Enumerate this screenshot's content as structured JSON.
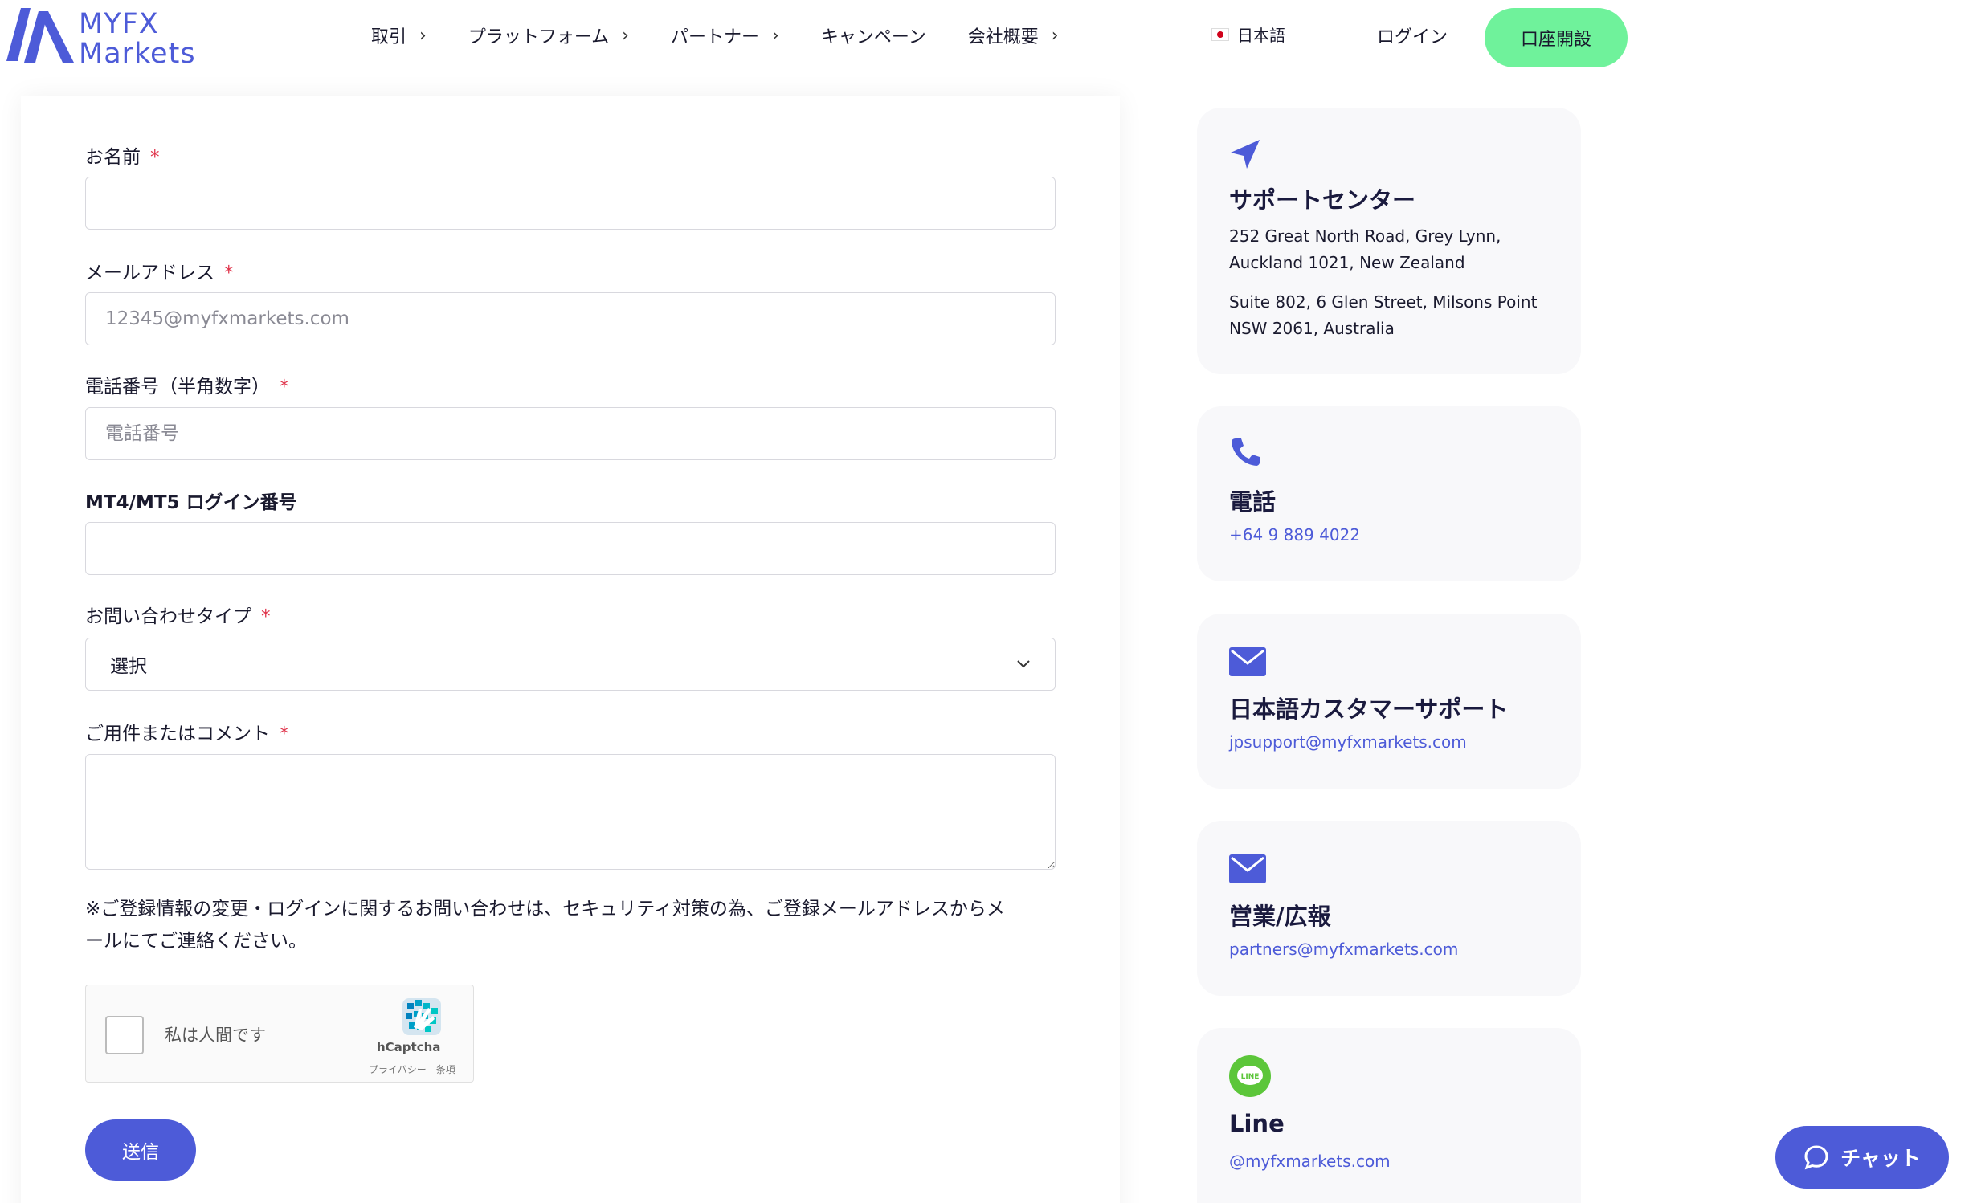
{
  "header": {
    "logo_line1": "MYFX",
    "logo_line2": "Markets",
    "nav": [
      {
        "label": "取引",
        "chevron": "›"
      },
      {
        "label": "プラットフォーム",
        "chevron": "›"
      },
      {
        "label": "パートナー",
        "chevron": "›"
      },
      {
        "label": "キャンペーン",
        "chevron": ""
      },
      {
        "label": "会社概要",
        "chevron": "›"
      }
    ],
    "language": "日本語",
    "login": "ログイン",
    "open_account": "口座開設"
  },
  "form": {
    "name_label": "お名前",
    "email_label": "メールアドレス",
    "email_placeholder": "12345@myfxmarkets.com",
    "phone_label": "電話番号（半角数字）",
    "phone_placeholder": "電話番号",
    "mt_login_label": "MT4/MT5 ログイン番号",
    "inquiry_type_label": "お問い合わせタイプ",
    "inquiry_type_value": "選択",
    "comment_label": "ご用件またはコメント",
    "required_mark": "*",
    "notice_line1": "※ご登録情報の変更・ログインに関するお問い合わせは、セキュリティ対策の為、ご登録メールアドレスからメ",
    "notice_line2": "ールにてご連絡ください。",
    "captcha_label": "私は人間です",
    "captcha_brand": "hCaptcha",
    "captcha_terms": "プライバシー - 条項",
    "submit": "送信"
  },
  "cards": {
    "support": {
      "icon": "location-arrow-icon",
      "title": "サポートセンター",
      "addr1_line1": "252 Great North Road, Grey Lynn,",
      "addr1_line2": "Auckland 1021, New Zealand",
      "addr2_line1": "Suite 802, 6 Glen Street, Milsons Point",
      "addr2_line2": "NSW 2061, Australia"
    },
    "phone": {
      "icon": "phone-icon",
      "title": "電話",
      "value": "+64 9 889 4022"
    },
    "jp_support": {
      "icon": "mail-icon",
      "title": "日本語カスタマーサポート",
      "value": "jpsupport@myfxmarkets.com"
    },
    "sales": {
      "icon": "mail-icon",
      "title": "営業/広報",
      "value": "partners@myfxmarkets.com"
    },
    "line": {
      "icon": "line-icon",
      "title": "Line",
      "value": "@myfxmarkets.com",
      "badge": "LINE"
    }
  },
  "chat": {
    "label": "チャット"
  },
  "colors": {
    "accent": "#4d5bd8",
    "cta": "#6ff29b",
    "required": "#e0344b",
    "line": "#5cc63a"
  }
}
